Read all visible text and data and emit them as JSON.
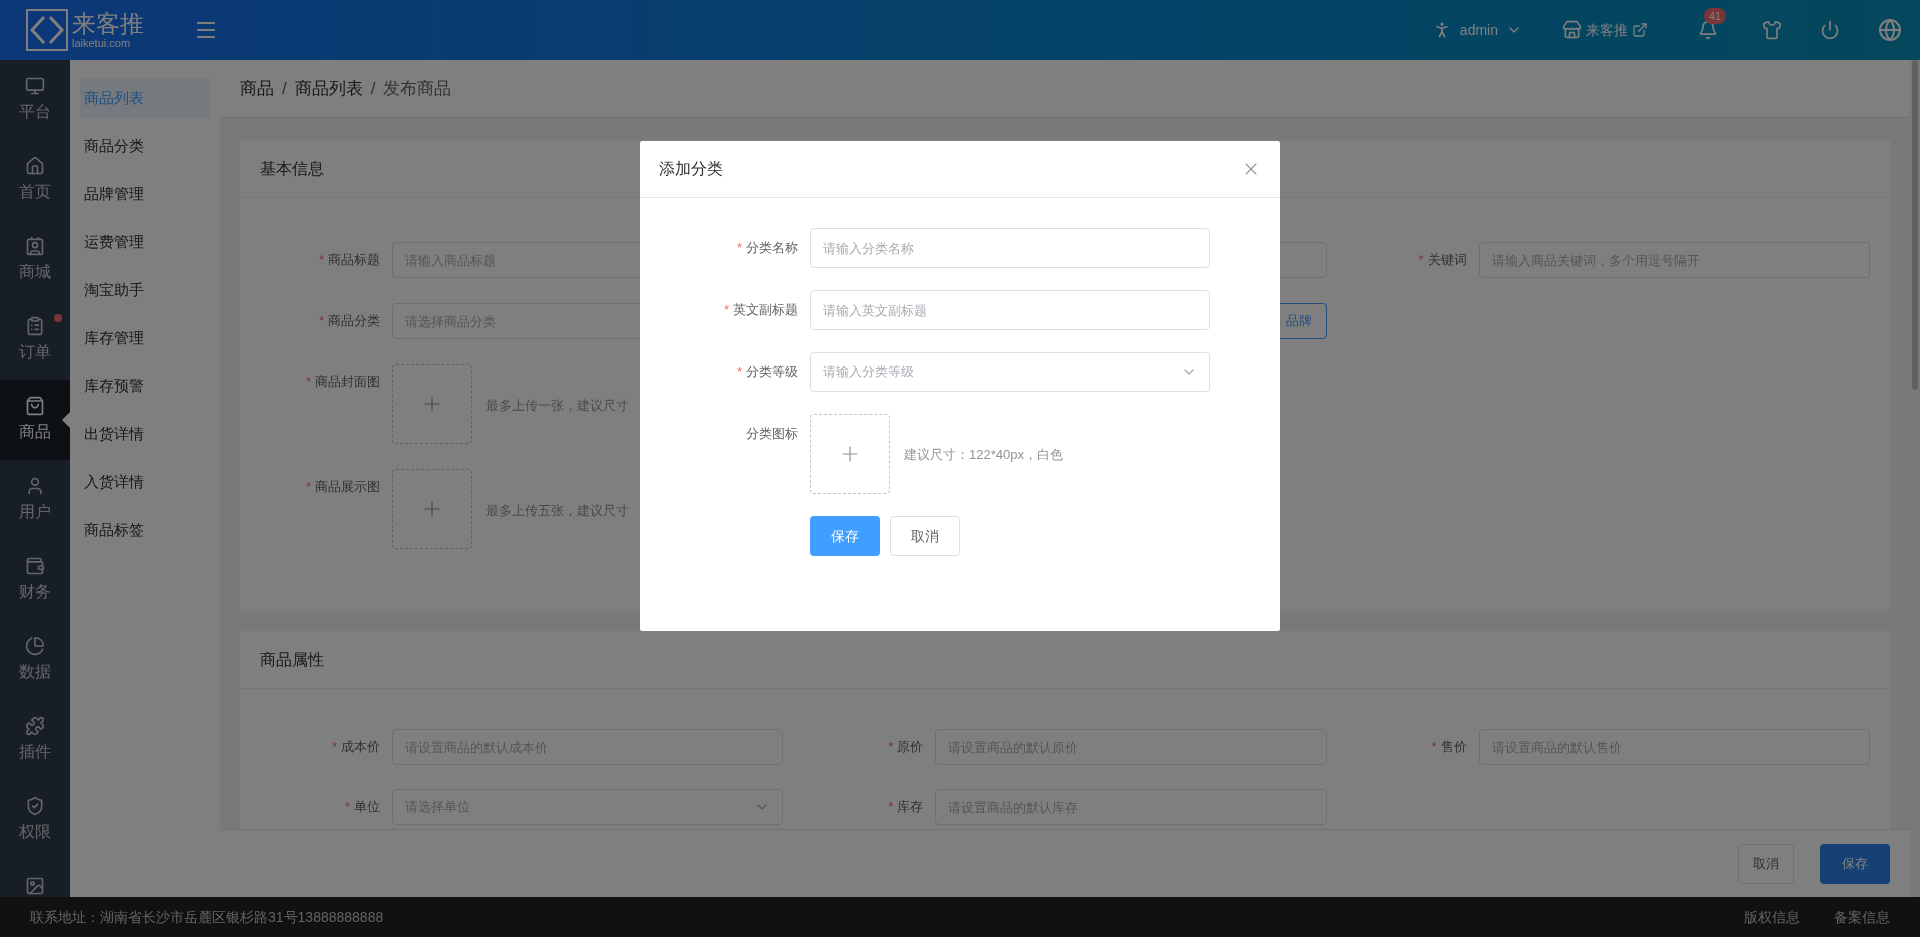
{
  "header": {
    "logo_text": "来客推",
    "logo_domain": "laiketui.com",
    "user": "admin",
    "shop": "来客推",
    "notifications": "41"
  },
  "nav": [
    {
      "label": "平台",
      "selected": false,
      "dot": false
    },
    {
      "label": "首页",
      "selected": false,
      "dot": false
    },
    {
      "label": "商城",
      "selected": false,
      "dot": false
    },
    {
      "label": "订单",
      "selected": false,
      "dot": true
    },
    {
      "label": "商品",
      "selected": true,
      "dot": false
    },
    {
      "label": "用户",
      "selected": false,
      "dot": false
    },
    {
      "label": "财务",
      "selected": false,
      "dot": false
    },
    {
      "label": "数据",
      "selected": false,
      "dot": false
    },
    {
      "label": "插件",
      "selected": false,
      "dot": false
    },
    {
      "label": "权限",
      "selected": false,
      "dot": false
    }
  ],
  "submenu": [
    {
      "label": "商品列表",
      "selected": true
    },
    {
      "label": "商品分类",
      "selected": false
    },
    {
      "label": "品牌管理",
      "selected": false
    },
    {
      "label": "运费管理",
      "selected": false
    },
    {
      "label": "淘宝助手",
      "selected": false
    },
    {
      "label": "库存管理",
      "selected": false
    },
    {
      "label": "库存预警",
      "selected": false
    },
    {
      "label": "出货详情",
      "selected": false
    },
    {
      "label": "入货详情",
      "selected": false
    },
    {
      "label": "商品标签",
      "selected": false
    }
  ],
  "breadcrumb": {
    "separator": "/",
    "items": [
      "商品",
      "商品列表",
      "发布商品"
    ]
  },
  "basic_info": {
    "title": "基本信息",
    "product_title": {
      "label": "商品标题",
      "mark": "*",
      "placeholder": "请输入商品标题"
    },
    "keywords": {
      "label": "关键词",
      "mark": "*",
      "placeholder": "请输入商品关键词，多个用逗号隔开"
    },
    "category": {
      "label": "商品分类",
      "mark": "*",
      "placeholder": "请选择商品分类"
    },
    "brand_button": "品牌",
    "uploads": [
      {
        "label": "商品封面图",
        "mark": "*",
        "hint": "最多上传一张，建议尺寸"
      },
      {
        "label": "商品展示图",
        "mark": "*",
        "hint": "最多上传五张，建议尺寸"
      }
    ]
  },
  "attributes": {
    "title": "商品属性",
    "fields": [
      {
        "label": "成本价",
        "mark": "*",
        "kind": "input",
        "placeholder": "请设置商品的默认成本价"
      },
      {
        "label": "原价",
        "mark": "*",
        "kind": "input",
        "placeholder": "请设置商品的默认原价"
      },
      {
        "label": "售价",
        "mark": "*",
        "kind": "input",
        "placeholder": "请设置商品的默认售价"
      },
      {
        "label": "单位",
        "mark": "*",
        "kind": "select",
        "placeholder": "请选择单位"
      },
      {
        "label": "库存",
        "mark": "*",
        "kind": "input",
        "placeholder": "请设置商品的默认库存"
      }
    ]
  },
  "page_actions": {
    "cancel": "取消",
    "save": "保存"
  },
  "footer": {
    "address": "联系地址：湖南省长沙市岳麓区银杉路31号13888888888",
    "links": [
      "版权信息",
      "备案信息"
    ]
  },
  "modal": {
    "title": "添加分类",
    "fields": [
      {
        "label": "分类名称",
        "mark": "*",
        "kind": "input",
        "placeholder": "请输入分类名称"
      },
      {
        "label": "英文副标题",
        "mark": "*",
        "kind": "input",
        "placeholder": "请输入英文副标题"
      },
      {
        "label": "分类等级",
        "mark": "*",
        "kind": "select",
        "placeholder": "请输入分类等级"
      },
      {
        "label": "分类图标",
        "kind": "upload",
        "hint": "建议尺寸：122*40px，白色"
      }
    ],
    "save": "保存",
    "cancel": "取消"
  }
}
